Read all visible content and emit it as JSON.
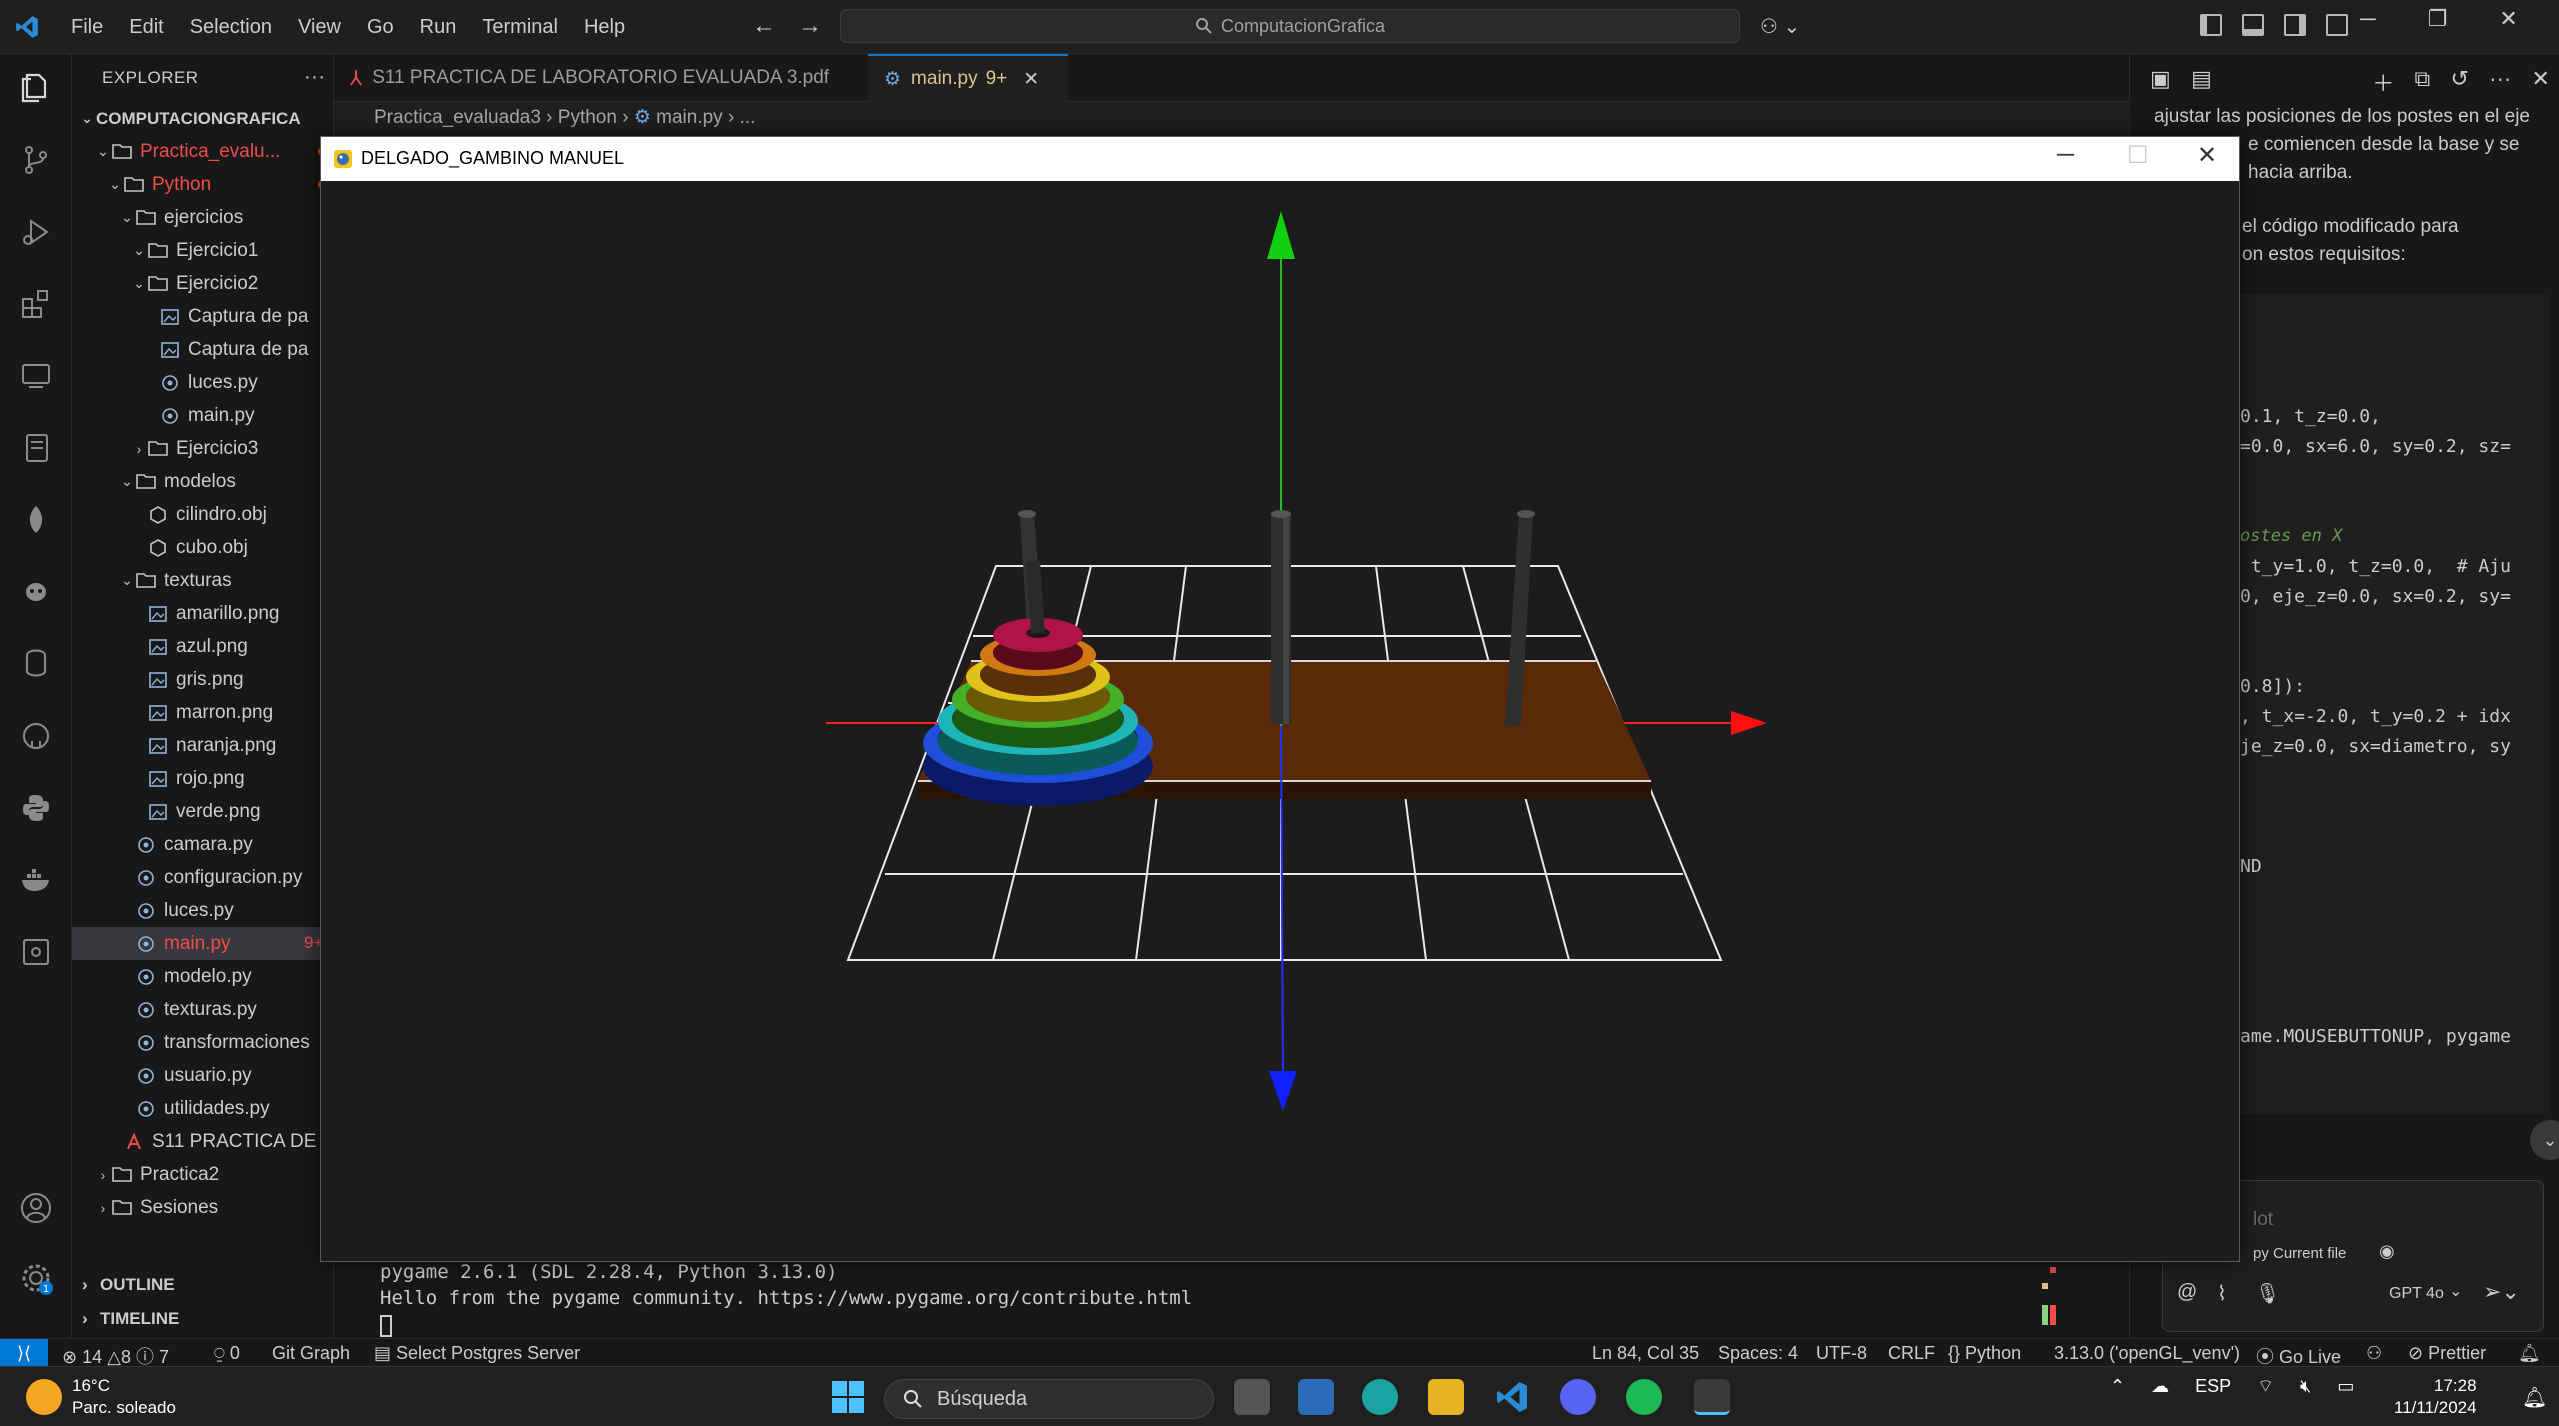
{
  "titlebar": {
    "menu": [
      "File",
      "Edit",
      "Selection",
      "View",
      "Go",
      "Run",
      "Terminal",
      "Help"
    ],
    "command_center": "ComputacionGrafica"
  },
  "sidebar": {
    "title": "EXPLORER",
    "workspace": "COMPUTACIONGRAFICA",
    "tree": [
      {
        "label": "Practica_evalu...",
        "indent": 1,
        "type": "folder-open",
        "color": "#f14c4c",
        "dot": true
      },
      {
        "label": "Python",
        "indent": 2,
        "type": "folder-open",
        "color": "#f14c4c",
        "dot": true
      },
      {
        "label": "ejercicios",
        "indent": 3,
        "type": "folder-open"
      },
      {
        "label": "Ejercicio1",
        "indent": 4,
        "type": "folder-open"
      },
      {
        "label": "Ejercicio2",
        "indent": 4,
        "type": "folder-open"
      },
      {
        "label": "Captura de pa",
        "indent": 5,
        "type": "image"
      },
      {
        "label": "Captura de pa",
        "indent": 5,
        "type": "image"
      },
      {
        "label": "luces.py",
        "indent": 5,
        "type": "python"
      },
      {
        "label": "main.py",
        "indent": 5,
        "type": "python"
      },
      {
        "label": "Ejercicio3",
        "indent": 4,
        "type": "folder-closed"
      },
      {
        "label": "modelos",
        "indent": 3,
        "type": "folder-open"
      },
      {
        "label": "cilindro.obj",
        "indent": 4,
        "type": "obj"
      },
      {
        "label": "cubo.obj",
        "indent": 4,
        "type": "obj"
      },
      {
        "label": "texturas",
        "indent": 3,
        "type": "folder-open"
      },
      {
        "label": "amarillo.png",
        "indent": 4,
        "type": "image"
      },
      {
        "label": "azul.png",
        "indent": 4,
        "type": "image"
      },
      {
        "label": "gris.png",
        "indent": 4,
        "type": "image"
      },
      {
        "label": "marron.png",
        "indent": 4,
        "type": "image"
      },
      {
        "label": "naranja.png",
        "indent": 4,
        "type": "image"
      },
      {
        "label": "rojo.png",
        "indent": 4,
        "type": "image"
      },
      {
        "label": "verde.png",
        "indent": 4,
        "type": "image"
      },
      {
        "label": "camara.py",
        "indent": 3,
        "type": "python"
      },
      {
        "label": "configuracion.py",
        "indent": 3,
        "type": "python"
      },
      {
        "label": "luces.py",
        "indent": 3,
        "type": "python"
      },
      {
        "label": "main.py",
        "indent": 3,
        "type": "python",
        "selected": true,
        "color": "#f14c4c",
        "badge": "9+"
      },
      {
        "label": "modelo.py",
        "indent": 3,
        "type": "python"
      },
      {
        "label": "texturas.py",
        "indent": 3,
        "type": "python"
      },
      {
        "label": "transformaciones",
        "indent": 3,
        "type": "python"
      },
      {
        "label": "usuario.py",
        "indent": 3,
        "type": "python"
      },
      {
        "label": "utilidades.py",
        "indent": 3,
        "type": "python"
      },
      {
        "label": "S11 PRACTICA DE",
        "indent": 2,
        "type": "pdf"
      },
      {
        "label": "Practica2",
        "indent": 1,
        "type": "folder-closed"
      },
      {
        "label": "Sesiones",
        "indent": 1,
        "type": "folder-closed"
      }
    ],
    "outline": "OUTLINE",
    "timeline": "TIMELINE"
  },
  "tabs": {
    "pdf_tab": "S11 PRACTICA DE LABORATORIO EVALUADA 3.pdf",
    "main_tab": "main.py",
    "main_badge": "9+"
  },
  "breadcrumb": {
    "folder": "Practica_evaluada3",
    "sub": "Python",
    "file": "main.py",
    "more": "..."
  },
  "pygame_window": {
    "title": "DELGADO_GAMBINO MANUEL"
  },
  "terminal": {
    "line1": "pygame 2.6.1 (SDL 2.28.4, Python 3.13.0)",
    "line2": "Hello from the pygame community. https://www.pygame.org/contribute.html"
  },
  "chat": {
    "p1_line1": "ajustar las posiciones de los postes en el eje",
    "p1_line2": "e comiencen desde la base y se",
    "p1_line3": "hacia arriba.",
    "p2_line1": "el código modificado para",
    "p2_line2": "on estos requisitos:",
    "code_lines": [
      {
        "text": "0.1, t_z=0.0,",
        "color": "#cccccc"
      },
      {
        "text": "=0.0, sx=6.0, sy=0.2, sz=",
        "color": "#cccccc"
      },
      {
        "text": "ostes en X",
        "color": "#6a9955"
      },
      {
        "text": " t_y=1.0, t_z=0.0,  # Aju",
        "color": "#cccccc"
      },
      {
        "text": "0, eje_z=0.0, sx=0.2, sy=",
        "color": "#cccccc"
      },
      {
        "text": "0.8]):",
        "color": "#cccccc"
      },
      {
        "text": ", t_x=-2.0, t_y=0.2 + idx",
        "color": "#cccccc"
      },
      {
        "text": "je_z=0.0, sx=diametro, sy",
        "color": "#cccccc"
      },
      {
        "text": "ND",
        "color": "#cccccc"
      },
      {
        "text": "ame.MOUSEBUTTONUP, pygame",
        "color": "#cccccc"
      }
    ],
    "input_placeholder": "lot",
    "context": "py Current file",
    "model": "GPT 4o"
  },
  "statusbar": {
    "errors": "14",
    "warnings": "8",
    "infos": "7",
    "ports": "0",
    "git_graph": "Git Graph",
    "postgres": "Select Postgres Server",
    "cursor": "Ln 84, Col 35",
    "spaces": "Spaces: 4",
    "encoding": "UTF-8",
    "eol": "CRLF",
    "language": "Python",
    "interpreter": "3.13.0 ('openGL_venv')",
    "go_live": "Go Live",
    "prettier": "Prettier"
  },
  "taskbar": {
    "temp": "16°C",
    "weather": "Parc. soleado",
    "search": "Búsqueda",
    "lang": "ESP",
    "time": "17:28",
    "date": "11/11/2024"
  }
}
